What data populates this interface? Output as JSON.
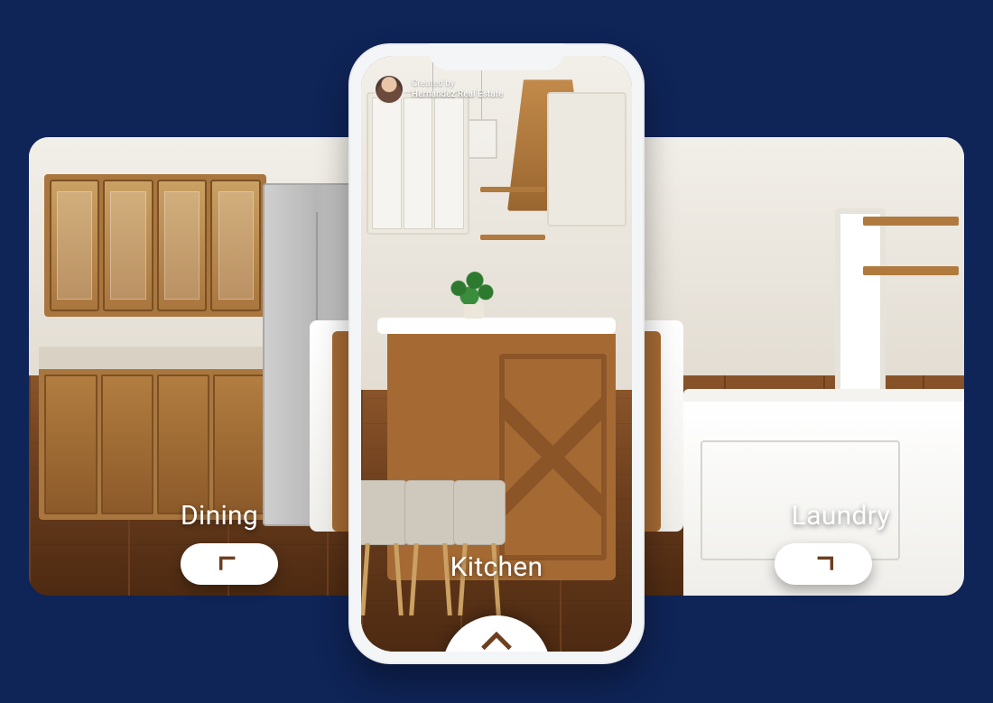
{
  "creator": {
    "line1": "Created by",
    "line2": "Hernandez Real Estate"
  },
  "navigation": {
    "left": {
      "label": "Dining",
      "icon": "chevron-back-left"
    },
    "center": {
      "label": "Kitchen",
      "icon": "chevron-up"
    },
    "right": {
      "label": "Laundry",
      "icon": "chevron-back-right"
    }
  },
  "colors": {
    "page_bg": "#0f2457",
    "pill_bg": "#ffffff",
    "chevron": "#6d3f1e"
  }
}
